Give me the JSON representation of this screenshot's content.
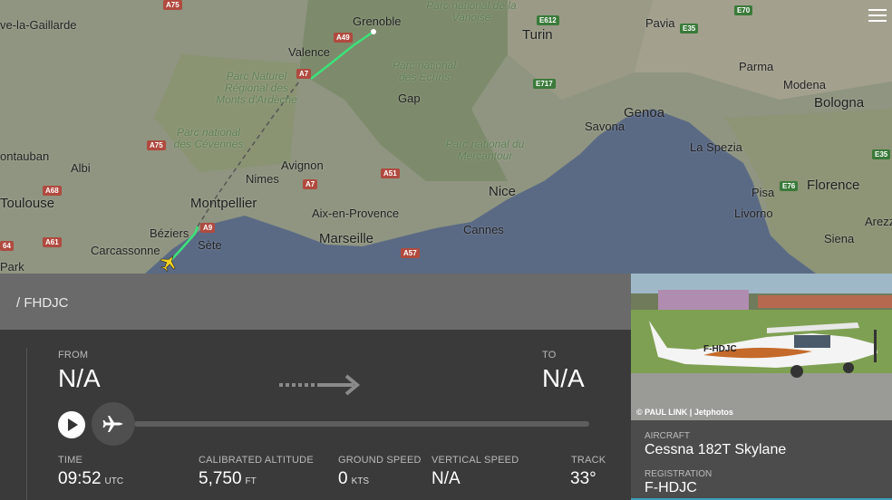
{
  "map": {
    "cities": {
      "grenoble": "Grenoble",
      "valence": "Valence",
      "turin": "Turin",
      "pavia": "Pavia",
      "parma": "Parma",
      "modena": "Modena",
      "bologna": "Bologna",
      "genoa": "Genoa",
      "savona": "Savona",
      "la_spezia": "La Spezia",
      "pisa": "Pisa",
      "florence": "Florence",
      "livorno": "Livorno",
      "arezzo": "Arezz",
      "siena": "Siena",
      "gap": "Gap",
      "nice": "Nice",
      "cannes": "Cannes",
      "avignon": "Avignon",
      "nimes": "Nimes",
      "montpellier": "Montpellier",
      "aix": "Aix-en-Provence",
      "marseille": "Marseille",
      "beziers": "Béziers",
      "sete": "Sète",
      "carcassonne": "Carcassonne",
      "toulouse": "Toulouse",
      "montauban": "ontauban",
      "albi": "Albi",
      "villeneuve": "ve-la-Gaillarde",
      "park_left": "Park"
    },
    "parks": {
      "vanoise": "Parc national de la Vanoise",
      "ardeche": "Parc Naturel Régional des Monts d'Ardèche",
      "ecrins": "Parc national des Écrins",
      "cevennes": "Parc national des Cévennes",
      "mercantour": "Parc national du Mercantour"
    },
    "roads": [
      "A75",
      "A49",
      "A7",
      "A75",
      "A68",
      "A61",
      "A9",
      "A7",
      "A51",
      "A57",
      "E612",
      "E70",
      "E35",
      "E717",
      "E76",
      "E35",
      "64"
    ]
  },
  "flight": {
    "callsign": "/ FHDJC",
    "from_label": "FROM",
    "from_value": "N/A",
    "to_label": "TO",
    "to_value": "N/A",
    "time_label": "TIME",
    "time_value": "09:52",
    "time_unit": "UTC",
    "alt_label": "CALIBRATED ALTITUDE",
    "alt_value": "5,750",
    "alt_unit": "FT",
    "gs_label": "GROUND SPEED",
    "gs_value": "0",
    "gs_unit": "KTS",
    "vs_label": "VERTICAL SPEED",
    "vs_value": "N/A",
    "track_label": "TRACK",
    "track_value": "33°"
  },
  "photo": {
    "credit": "© PAUL LINK | Jetphotos",
    "registration_text": "F-HDJC"
  },
  "aircraft": {
    "aircraft_label": "AIRCRAFT",
    "aircraft_value": "Cessna 182T Skylane",
    "registration_label": "REGISTRATION",
    "registration_value": "F-HDJC"
  },
  "colors": {
    "sea": "#5a6a85",
    "land": "#8b9279",
    "track": "#3ce27a",
    "panel": "#3a3a3a",
    "accent": "#3aa0b8"
  }
}
